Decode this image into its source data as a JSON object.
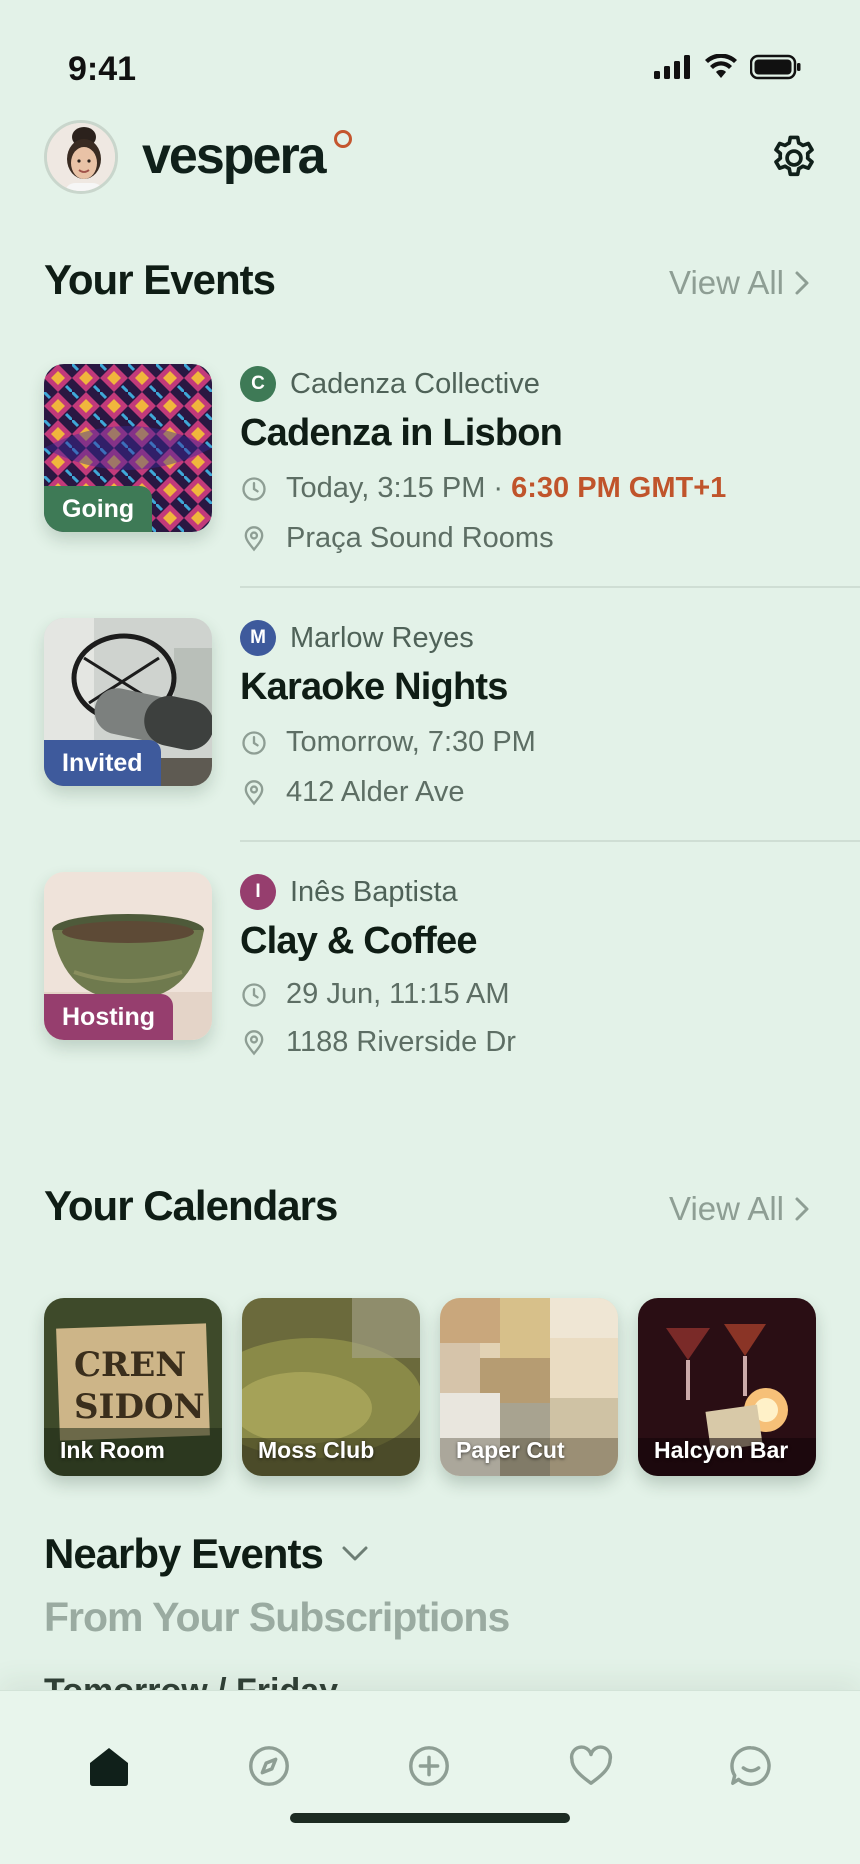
{
  "status_bar": {
    "time": "9:41"
  },
  "header": {
    "brand": "vespera",
    "accent_color": "#c4562e"
  },
  "your_events": {
    "title": "Your Events",
    "view_all": "View All",
    "items": [
      {
        "badge": "Going",
        "badge_color": "#3e7a56",
        "org_initial": "C",
        "org_color": "#3e7a56",
        "org_name": "Cadenza Collective",
        "title": "Cadenza in Lisbon",
        "time": "Today, 3:15 PM ·",
        "time_local": "6:30 PM GMT+1",
        "location": "Praça Sound Rooms"
      },
      {
        "badge": "Invited",
        "badge_color": "#3e5a9c",
        "org_initial": "M",
        "org_color": "#3e5a9c",
        "org_name": "Marlow Reyes",
        "title": "Karaoke Nights",
        "time": "Tomorrow, 7:30 PM",
        "location": "412 Alder Ave"
      },
      {
        "badge": "Hosting",
        "badge_color": "#963e6e",
        "org_initial": "I",
        "org_color": "#963e6e",
        "org_name": "Inês Baptista",
        "title": "Clay & Coffee",
        "time": "29 Jun, 11:15 AM",
        "location": "1188 Riverside Dr"
      }
    ]
  },
  "your_calendars": {
    "title": "Your Calendars",
    "view_all": "View All",
    "items": [
      {
        "label": "Ink Room"
      },
      {
        "label": "Moss Club"
      },
      {
        "label": "Paper Cut"
      },
      {
        "label": "Halcyon Bar"
      }
    ]
  },
  "nearby": {
    "title": "Nearby Events",
    "subtitle": "From Your Subscriptions",
    "peek": "Tomorrow / Friday"
  },
  "tabbar": {
    "tabs": [
      "home-icon",
      "compass-icon",
      "plus-circle-icon",
      "heart-icon",
      "chat-icon"
    ]
  }
}
